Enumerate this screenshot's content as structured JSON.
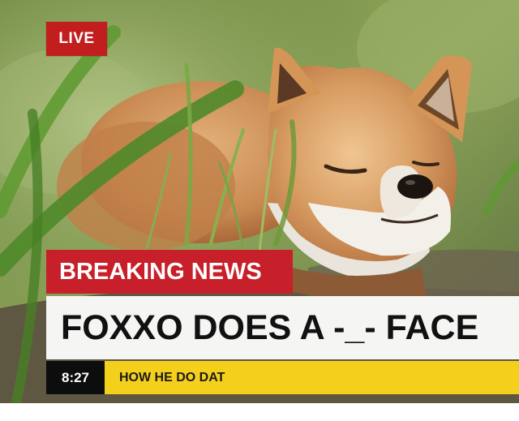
{
  "live_label": "LIVE",
  "breaking_label": "BREAKING NEWS",
  "headline": "FOXXO DOES A -_- FACE",
  "time": "8:27",
  "ticker": "HOW HE DO DAT",
  "colors": {
    "live_red": "#c21e1e",
    "breaking_red": "#c8202a",
    "headline_bg": "#f5f5f3",
    "ticker_yellow": "#f4d01c",
    "time_bg": "#0d0d0d"
  }
}
